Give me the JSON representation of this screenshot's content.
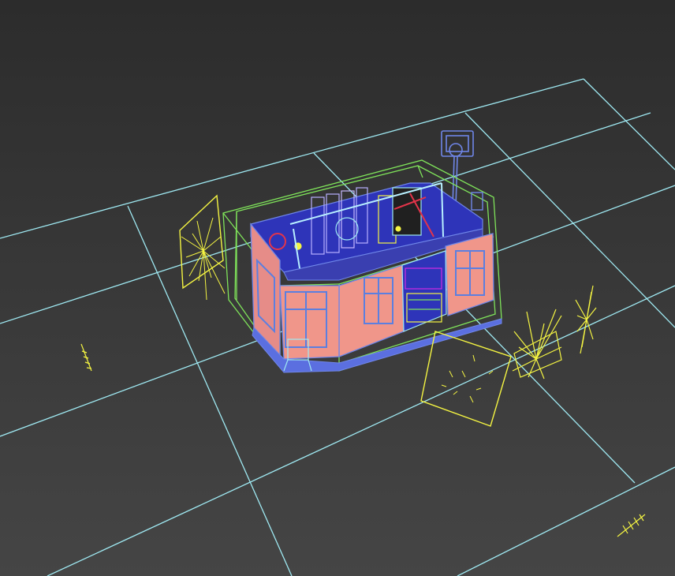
{
  "viewport": {
    "label": "",
    "shading": "wireframe",
    "view": "perspective",
    "background_color": "#3b3b3b",
    "grid_color": "#9fe9f2"
  },
  "scene": {
    "colors": {
      "wall_fill": "#f0968a",
      "wall_edge": "#6f86e8",
      "interior": "#2e34b9",
      "window_blue": "#5b7fe0",
      "bounding_boxes": "#7fe35a",
      "lights": "#f5f542",
      "camera": "#6f86e8",
      "accent_red": "#e3344a",
      "accent_magenta": "#d22ce3",
      "accent_cyan": "#6fe3e3"
    },
    "objects": [
      {
        "kind": "building",
        "icon": "building-wireframe-icon"
      },
      {
        "kind": "light",
        "icon": "area-light-icon",
        "count": 3
      },
      {
        "kind": "light",
        "icon": "spot-light-icon",
        "count": 4
      },
      {
        "kind": "camera",
        "icon": "camera-icon",
        "count": 1
      }
    ]
  }
}
